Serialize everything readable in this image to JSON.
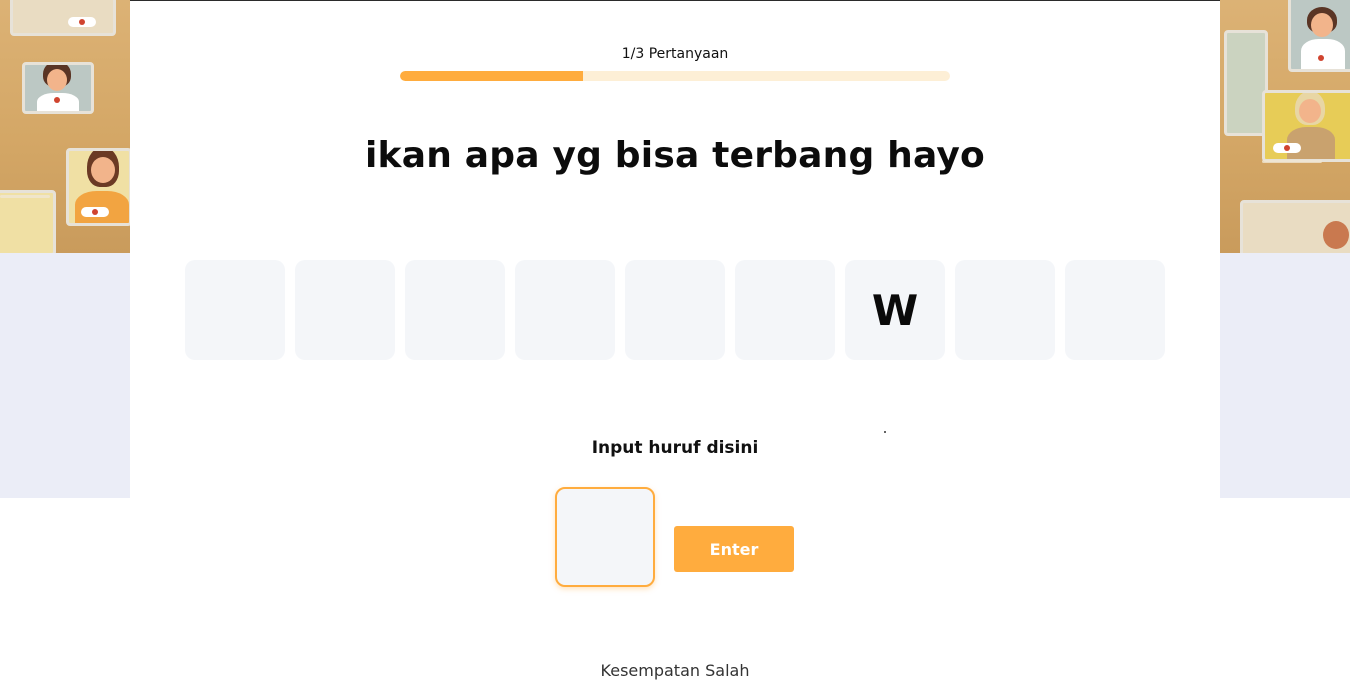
{
  "progress": {
    "label": "1/3 Pertanyaan",
    "fraction": 0.333
  },
  "question": "ikan apa yg bisa terbang hayo",
  "answer_slots": [
    "",
    "",
    "",
    "",
    "",
    "",
    "W",
    "",
    ""
  ],
  "input": {
    "label": "Input huruf disini",
    "value": "",
    "placeholder": ""
  },
  "enter_button": {
    "label": "Enter"
  },
  "chances_label": "Kesempatan Salah",
  "colors": {
    "accent": "#ffac3e",
    "track": "#fdefd6",
    "slot": "#f4f6f9",
    "banner": "#d4a766",
    "lavender": "#ebedf7"
  }
}
